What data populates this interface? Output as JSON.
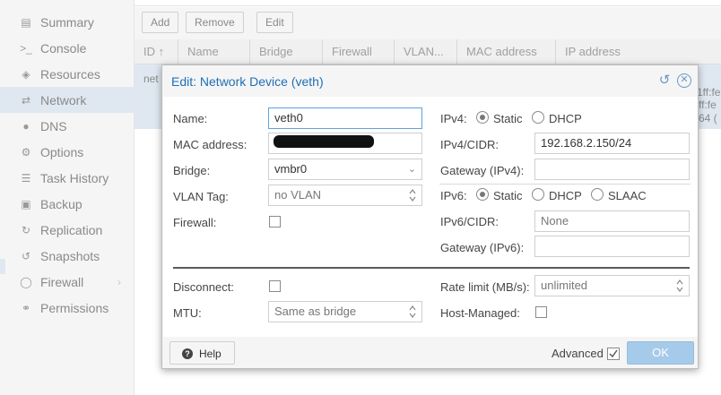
{
  "sidebar": {
    "items": [
      {
        "icon": "summary-icon",
        "label": "Summary"
      },
      {
        "icon": "console-icon",
        "label": "Console"
      },
      {
        "icon": "resources-icon",
        "label": "Resources"
      },
      {
        "icon": "network-icon",
        "label": "Network",
        "active": true
      },
      {
        "icon": "dns-icon",
        "label": "DNS"
      },
      {
        "icon": "gear-icon",
        "label": "Options"
      },
      {
        "icon": "task-history-icon",
        "label": "Task History"
      },
      {
        "icon": "backup-icon",
        "label": "Backup"
      },
      {
        "icon": "replication-icon",
        "label": "Replication"
      },
      {
        "icon": "snapshots-icon",
        "label": "Snapshots"
      },
      {
        "icon": "firewall-shield-icon",
        "label": "Firewall"
      },
      {
        "icon": "unlock-icon",
        "label": "Permissions"
      }
    ]
  },
  "toolbar": {
    "add": "Add",
    "remove": "Remove",
    "edit": "Edit"
  },
  "grid": {
    "columns": [
      "ID ↑",
      "Name",
      "Bridge",
      "Firewall",
      "VLAN...",
      "MAC address",
      "IP address"
    ],
    "row": {
      "id_partial": "net",
      "ip_partial_1": "1ff:fe",
      "ip_partial_2": "ff:fe",
      "ip_partial_3": "64 ("
    }
  },
  "dialog": {
    "title": "Edit: Network Device (veth)",
    "left": {
      "name_label": "Name:",
      "name_value": "veth0",
      "mac_label": "MAC address:",
      "bridge_label": "Bridge:",
      "bridge_value": "vmbr0",
      "vlan_label": "VLAN Tag:",
      "vlan_value": "no VLAN",
      "firewall_label": "Firewall:"
    },
    "right": {
      "ipv4_label": "IPv4:",
      "ipv4_static": "Static",
      "ipv4_dhcp": "DHCP",
      "ipv4_cidr_label": "IPv4/CIDR:",
      "ipv4_cidr_value": "192.168.2.150/24",
      "gateway4_label": "Gateway (IPv4):",
      "gateway4_value": "",
      "ipv6_label": "IPv6:",
      "ipv6_static": "Static",
      "ipv6_dhcp": "DHCP",
      "ipv6_slaac": "SLAAC",
      "ipv6_cidr_label": "IPv6/CIDR:",
      "ipv6_cidr_value": "None",
      "gateway6_label": "Gateway (IPv6):",
      "gateway6_value": ""
    },
    "advanced": {
      "disconnect_label": "Disconnect:",
      "mtu_label": "MTU:",
      "mtu_value": "Same as bridge",
      "rate_label": "Rate limit (MB/s):",
      "rate_value": "unlimited",
      "host_managed_label": "Host-Managed:"
    },
    "footer": {
      "help": "Help",
      "advanced": "Advanced",
      "ok": "OK"
    },
    "state": {
      "ipv4_mode": "Static",
      "ipv6_mode": "Static",
      "advanced_checked": true,
      "firewall_checked": false,
      "disconnect_checked": false,
      "host_managed_checked": false
    }
  }
}
